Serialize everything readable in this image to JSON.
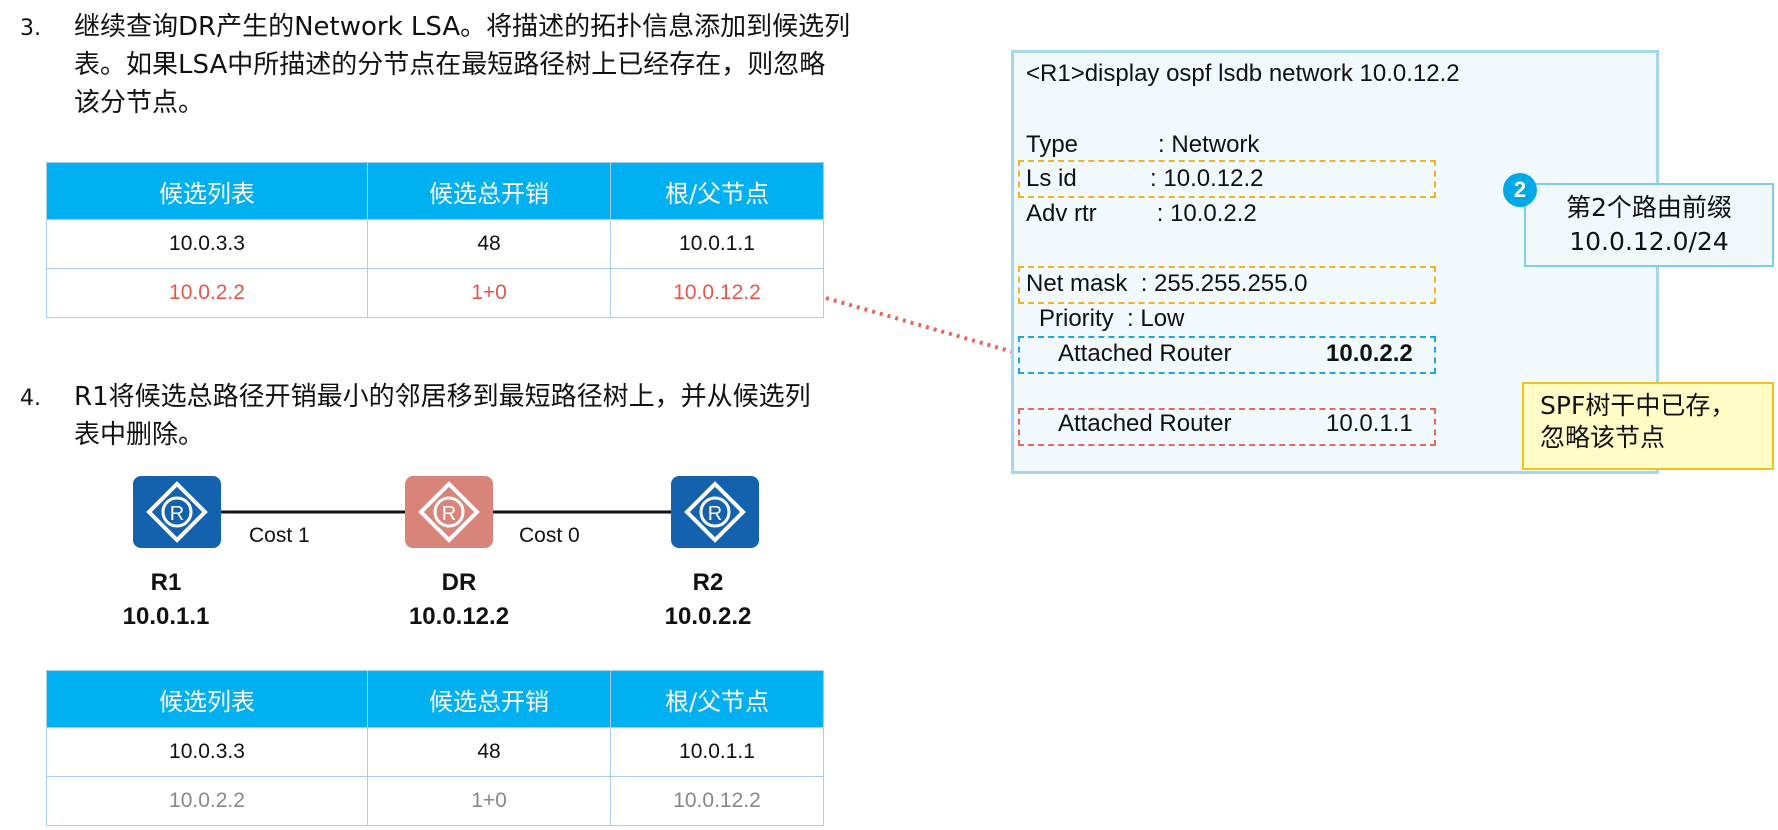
{
  "step3": {
    "number": "3.",
    "lines": [
      "继续查询DR产生的Network LSA。将描述的拓扑信息添加到候选列",
      "表。如果LSA中所描述的分节点在最短路径树上已经存在，则忽略",
      "该分节点。"
    ]
  },
  "table1": {
    "headers": [
      "候选列表",
      "候选总开销",
      "根/父节点"
    ],
    "rows": [
      {
        "list": "10.0.3.3",
        "cost": "48",
        "parent": "10.0.1.1"
      },
      {
        "list": "10.0.2.2",
        "cost": "1+0",
        "parent": "10.0.12.2"
      }
    ]
  },
  "step4": {
    "number": "4.",
    "lines": [
      "R1将候选总路径开销最小的邻居移到最短路径树上，并从候选列",
      "表中删除。"
    ]
  },
  "topology": {
    "routers": [
      {
        "name": "R1",
        "id": "10.0.1.1",
        "color": "#1461ad"
      },
      {
        "name": "DR",
        "id": "10.0.12.2",
        "color": "#d9847a"
      },
      {
        "name": "R2",
        "id": "10.0.2.2",
        "color": "#1461ad"
      }
    ],
    "links": [
      {
        "label": "Cost 1"
      },
      {
        "label": "Cost 0"
      }
    ],
    "icon_letter": "R"
  },
  "table2": {
    "headers": [
      "候选列表",
      "候选总开销",
      "根/父节点"
    ],
    "rows": [
      {
        "list": "10.0.3.3",
        "cost": "48",
        "parent": "10.0.1.1"
      },
      {
        "list": "10.0.2.2",
        "cost": "1+0",
        "parent": "10.0.12.2"
      }
    ]
  },
  "console": {
    "command": "<R1>display ospf lsdb network 10.0.12.2",
    "type_line": "Type            : Network",
    "lsid_line": "Ls id           : 10.0.12.2",
    "advrtr_line": "Adv rtr         : 10.0.2.2",
    "netmask_line": "Net mask  : 255.255.255.0",
    "priority_line": "Priority  : Low",
    "attached1_label": "Attached Router",
    "attached1_value": "10.0.2.2",
    "attached2_label": "Attached Router",
    "attached2_value": "10.0.1.1"
  },
  "callout_prefix": {
    "badge": "2",
    "title": "第2个路由前缀",
    "value": "10.0.12.0/24"
  },
  "callout_ignore": {
    "lines": [
      "SPF树干中已存，",
      "忽略该节点"
    ]
  },
  "colors": {
    "header_blue": "#00b0f0",
    "highlight_red": "#e8564a",
    "dashed_yellow": "#f0b323",
    "dashed_blue": "#1ba8e8",
    "dashed_red": "#e8675c"
  }
}
